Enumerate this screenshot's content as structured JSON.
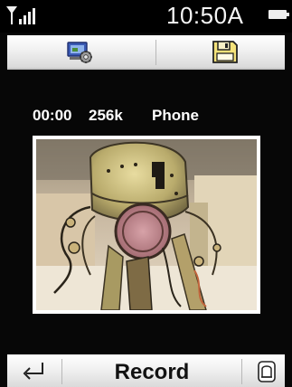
{
  "status_bar": {
    "signal_icon": "signal-strength-icon",
    "time": "10:50A",
    "battery_icon": "battery-icon"
  },
  "toolbar": {
    "left_icon": "camera-settings-icon",
    "right_icon": "save-to-memory-icon"
  },
  "recording_info": {
    "elapsed": "00:00",
    "bitrate": "256k",
    "storage": "Phone"
  },
  "preview": {
    "icon": "camera-preview-image"
  },
  "softkeys": {
    "left_icon": "back-arrow-icon",
    "center_label": "Record",
    "right_icon": "gallery-icon"
  }
}
